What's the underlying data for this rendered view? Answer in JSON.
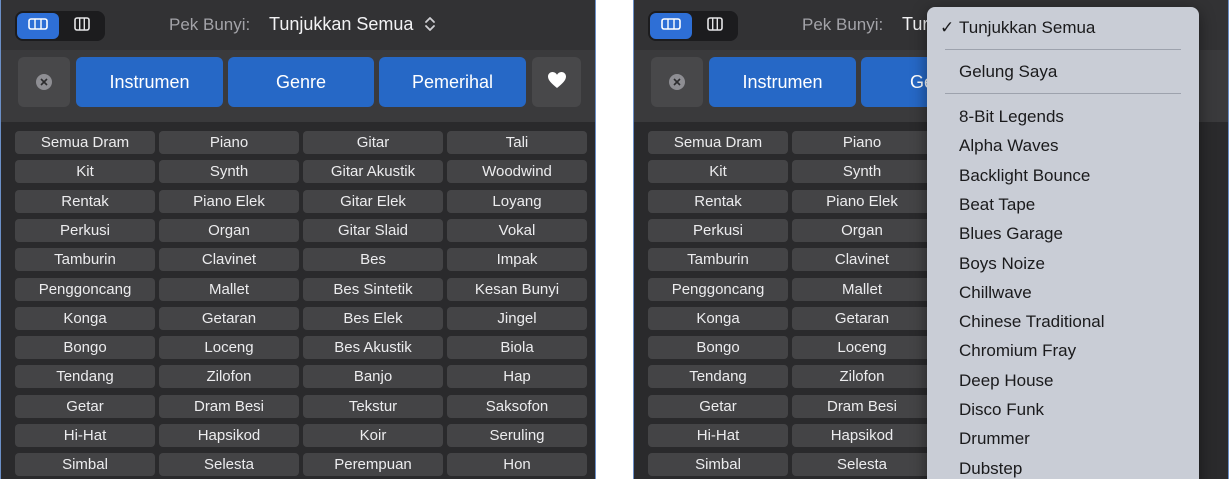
{
  "pack_selector": {
    "label": "Pek Bunyi:",
    "value": "Tunjukkan Semua",
    "value_truncated": "Tur"
  },
  "filters": {
    "instrument": "Instrumen",
    "genre": "Genre",
    "genre_truncated": "Ge",
    "descriptor": "Pemerihal"
  },
  "tags": [
    [
      "Semua Dram",
      "Piano",
      "Gitar",
      "Tali"
    ],
    [
      "Kit",
      "Synth",
      "Gitar Akustik",
      "Woodwind"
    ],
    [
      "Rentak",
      "Piano Elek",
      "Gitar Elek",
      "Loyang"
    ],
    [
      "Perkusi",
      "Organ",
      "Gitar Slaid",
      "Vokal"
    ],
    [
      "Tamburin",
      "Clavinet",
      "Bes",
      "Impak"
    ],
    [
      "Penggoncang",
      "Mallet",
      "Bes Sintetik",
      "Kesan Bunyi"
    ],
    [
      "Konga",
      "Getaran",
      "Bes Elek",
      "Jingel"
    ],
    [
      "Bongo",
      "Loceng",
      "Bes Akustik",
      "Biola"
    ],
    [
      "Tendang",
      "Zilofon",
      "Banjo",
      "Hap"
    ],
    [
      "Getar",
      "Dram Besi",
      "Tekstur",
      "Saksofon"
    ],
    [
      "Hi-Hat",
      "Hapsikod",
      "Koir",
      "Seruling"
    ],
    [
      "Simbal",
      "Selesta",
      "Perempuan",
      "Hon"
    ]
  ],
  "dropdown": {
    "selected": "Tunjukkan Semua",
    "my_loops": "Gelung Saya",
    "packs": [
      "8-Bit Legends",
      "Alpha Waves",
      "Backlight Bounce",
      "Beat Tape",
      "Blues Garage",
      "Boys Noize",
      "Chillwave",
      "Chinese Traditional",
      "Chromium Fray",
      "Deep House",
      "Disco Funk",
      "Drummer",
      "Dubstep"
    ]
  },
  "colors": {
    "accent": "#2668c6",
    "panel_bg": "#2c2c2e",
    "tag_bg": "#444446",
    "menu_bg": "#c9cdd6"
  },
  "icons": {
    "view_list": "list-view-icon",
    "view_columns": "column-view-icon",
    "clear": "clear-filter-icon",
    "favorite": "heart-icon",
    "chevron": "up-down-chevron-icon",
    "check": "checkmark-icon"
  }
}
